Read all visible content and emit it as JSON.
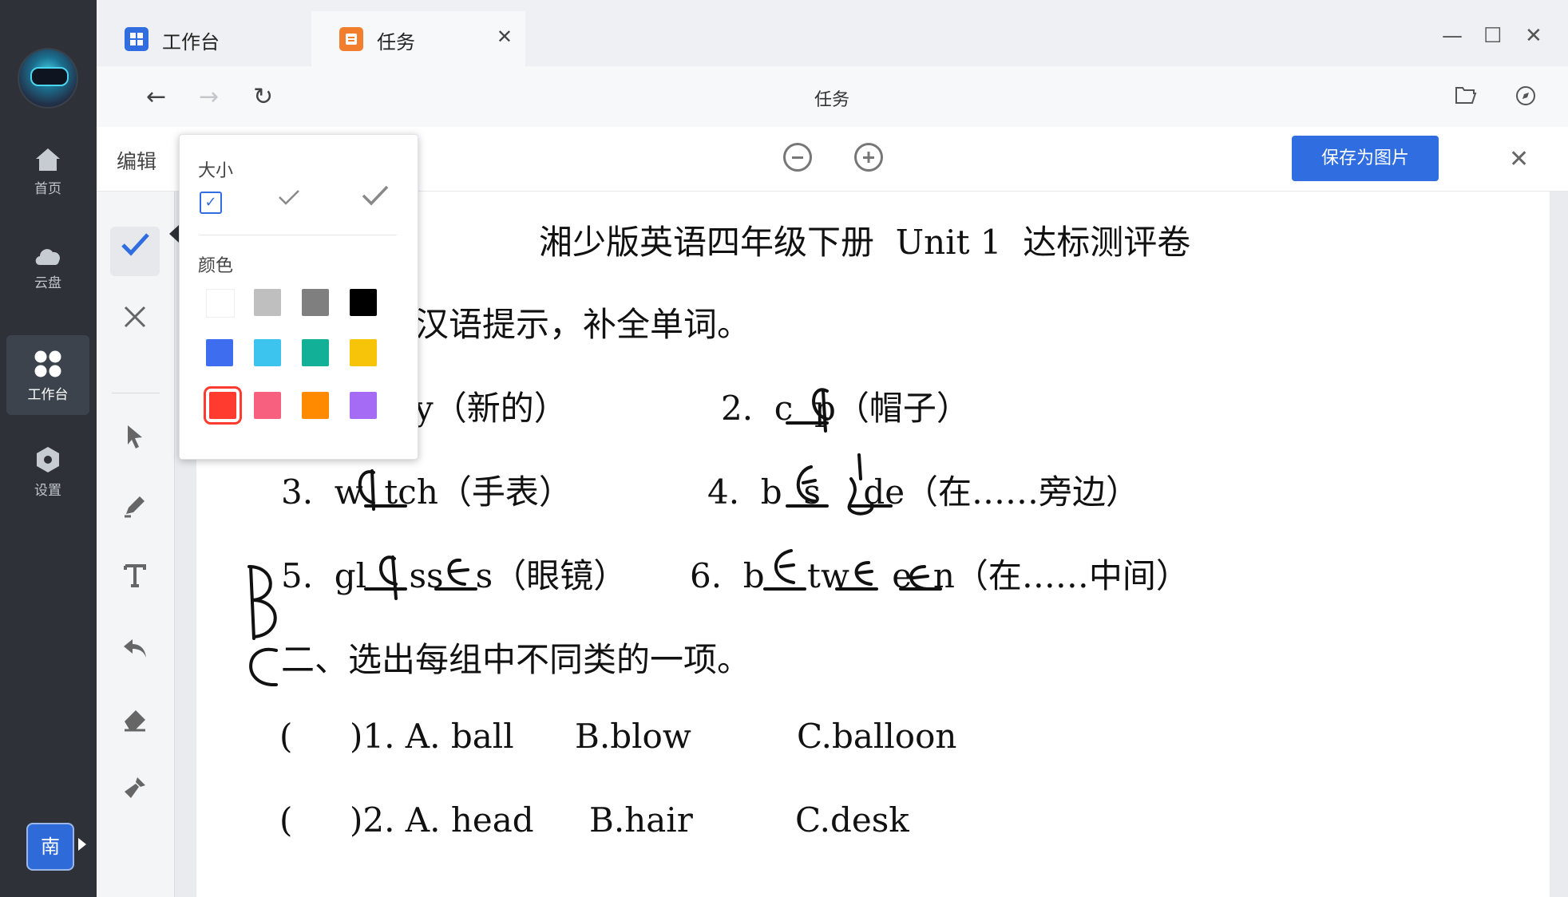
{
  "rail": {
    "items": [
      {
        "label": "首页",
        "icon": "home-icon"
      },
      {
        "label": "云盘",
        "icon": "cloud-icon"
      },
      {
        "label": "工作台",
        "icon": "grid-icon",
        "active": true
      },
      {
        "label": "设置",
        "icon": "settings-hex-icon"
      }
    ],
    "user_badge": "南"
  },
  "tabs": [
    {
      "label": "工作台",
      "icon": "workbench-app-icon",
      "active": false
    },
    {
      "label": "任务",
      "icon": "task-app-icon",
      "active": true
    }
  ],
  "nav": {
    "page_title": "任务"
  },
  "editbar": {
    "label": "编辑",
    "save_label": "保存为图片"
  },
  "popup": {
    "size_label": "大小",
    "color_label": "颜色",
    "colors": [
      [
        "#ffffff",
        "#bfbfbf",
        "#7f7f7f",
        "#000000"
      ],
      [
        "#3f6df0",
        "#3cc3ee",
        "#12b096",
        "#f8c409"
      ],
      [
        "#ff3b30",
        "#f7607f",
        "#ff8a00",
        "#a66bf5"
      ]
    ],
    "selected_color": "#ff3b30"
  },
  "document": {
    "title": "湘少版英语四年级下册  Unit 1  达标测评卷",
    "section1": "一、根据汉语提示，补全单词。",
    "section1_visible": "据汉语提示，补全单词。",
    "items": [
      {
        "text": "y（新的）"
      },
      {
        "text": "2.  c  p（帽子）"
      },
      {
        "text": "3.  w  tch（手表）"
      },
      {
        "text": "4.  b  s    de（在……旁边）"
      },
      {
        "text": "5.  gl    ss   s（眼镜）"
      },
      {
        "text": "6.  b    tw    e  n（在……中间）"
      }
    ],
    "section2": "二、选出每组中不同类的一项。",
    "mc": [
      {
        "paren": "(",
        "close": ")1. A. ball",
        "b": "B.blow",
        "c": "C.balloon"
      },
      {
        "paren": "(",
        "close": ")2. A. head",
        "b": "B.hair",
        "c": "C.desk"
      }
    ]
  },
  "colors": {
    "accent": "#2f6de0",
    "rail_bg": "#2e3238"
  }
}
